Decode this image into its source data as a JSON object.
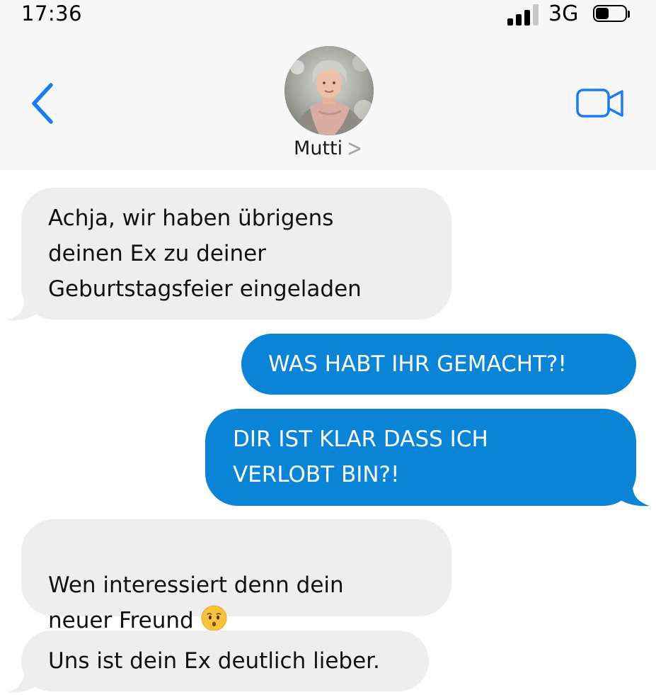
{
  "status_bar": {
    "time": "17:36",
    "network": "3G",
    "battery_level": 0.45
  },
  "header": {
    "contact_name": "Mutti",
    "back_icon": "chevron-left-icon",
    "video_icon": "video-camera-icon",
    "accent_color": "#1a7cf0"
  },
  "messages": [
    {
      "direction": "incoming",
      "text": "Achja, wir haben übrigens\ndeinen Ex zu deiner\nGeburtstagsfeier eingeladen"
    },
    {
      "direction": "outgoing",
      "text": "WAS HABT IHR GEMACHT?!"
    },
    {
      "direction": "outgoing",
      "text": "DIR IST KLAR DASS ICH\nVERLOBT BIN?!"
    },
    {
      "direction": "incoming",
      "text": "Wen interessiert denn dein\nneuer Freund",
      "emoji": "kissing-face-emoji"
    },
    {
      "direction": "incoming",
      "text": "Uns ist dein Ex deutlich lieber."
    }
  ],
  "colors": {
    "incoming_bubble": "#eeeeee",
    "outgoing_bubble": "#0a84d6",
    "header_background": "#f7f7f7"
  }
}
